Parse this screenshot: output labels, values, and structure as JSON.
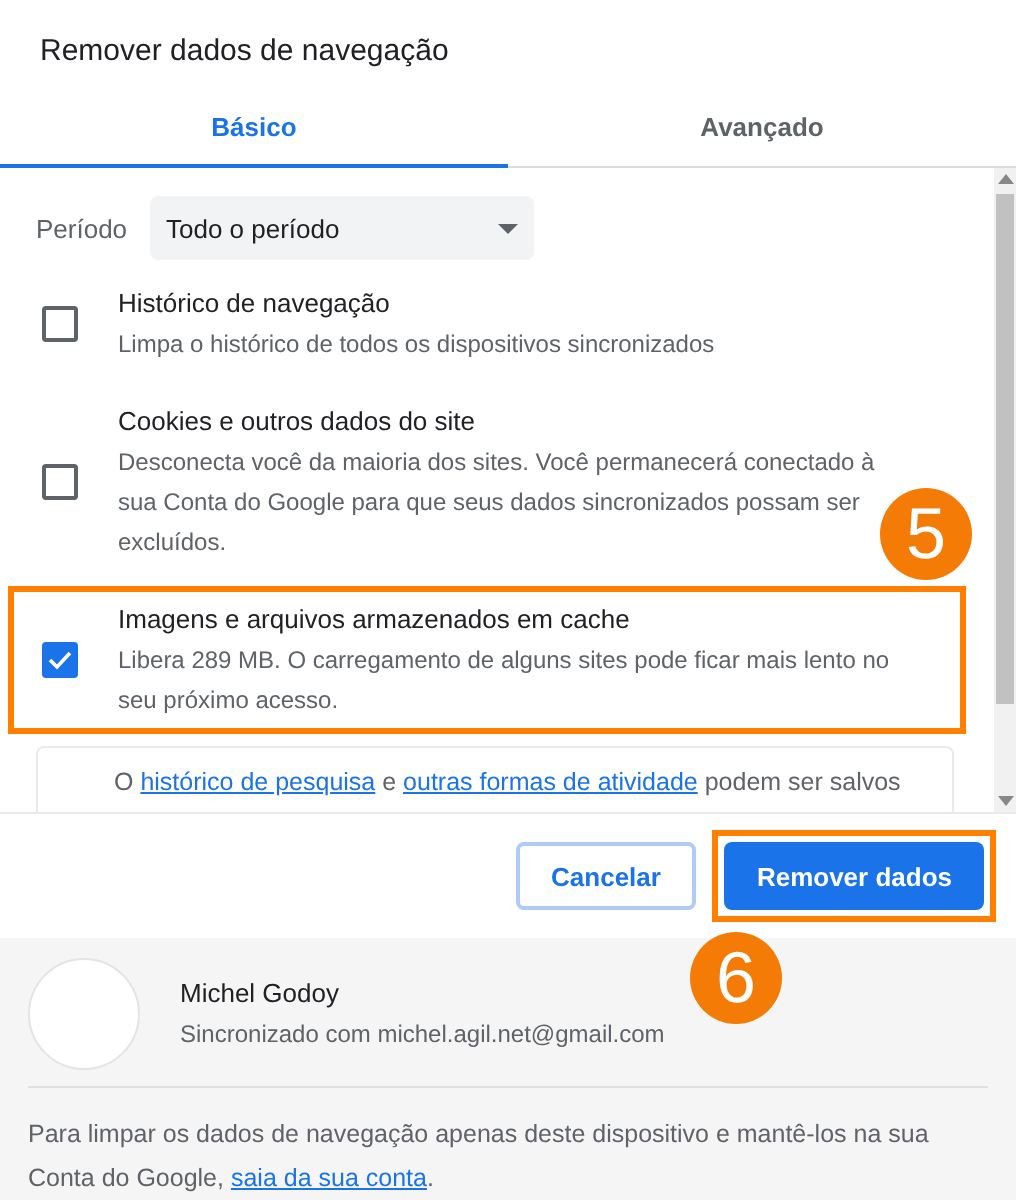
{
  "dialog": {
    "title": "Remover dados de navegação"
  },
  "tabs": [
    {
      "label": "Básico",
      "selected": true
    },
    {
      "label": "Avançado",
      "selected": false
    }
  ],
  "period": {
    "label": "Período",
    "value": "Todo o período"
  },
  "options": [
    {
      "title": "Histórico de navegação",
      "description": "Limpa o histórico de todos os dispositivos sincronizados",
      "checked": false,
      "highlighted": false
    },
    {
      "title": "Cookies e outros dados do site",
      "description": "Desconecta você da maioria dos sites. Você permanecerá conectado à sua Conta do Google para que seus dados sincronizados possam ser excluídos.",
      "checked": false,
      "highlighted": false
    },
    {
      "title": "Imagens e arquivos armazenados em cache",
      "description": "Libera 289 MB. O carregamento de alguns sites pode ficar mais lento no seu próximo acesso.",
      "checked": true,
      "highlighted": true
    }
  ],
  "note": [
    {
      "text": "O ",
      "kind": "text"
    },
    {
      "text": "histórico de pesquisa",
      "kind": "link"
    },
    {
      "text": " e ",
      "kind": "text"
    },
    {
      "text": "outras formas de atividade",
      "kind": "link"
    },
    {
      "text": " podem ser salvos",
      "kind": "text"
    }
  ],
  "buttons": [
    {
      "label": "Cancelar",
      "kind": "secondary",
      "highlighted": false
    },
    {
      "label": "Remover dados",
      "kind": "primary",
      "highlighted": true
    }
  ],
  "account": {
    "name": "Michel Godoy",
    "sync": "Sincronizado com michel.agil.net@gmail.com"
  },
  "footer_note": [
    {
      "text": "Para limpar os dados de navegação apenas deste dispositivo e mantê-los na sua Conta do Google, ",
      "kind": "text"
    },
    {
      "text": "saia da sua conta",
      "kind": "link"
    },
    {
      "text": ".",
      "kind": "text"
    }
  ],
  "annotations": [
    {
      "label": "5"
    },
    {
      "label": "6"
    }
  ]
}
